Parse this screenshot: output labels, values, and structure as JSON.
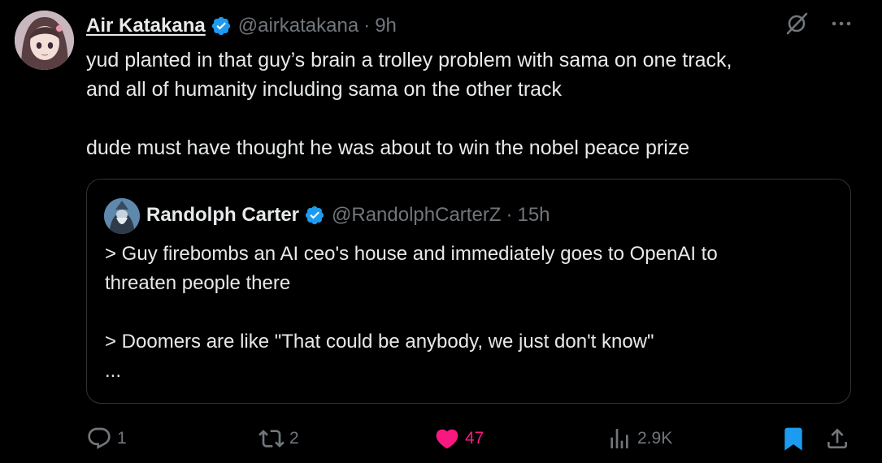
{
  "tweet": {
    "author": {
      "display_name": "Air Katakana",
      "handle": "@airkatakana",
      "verified": true
    },
    "separator": "·",
    "time": "9h",
    "text": [
      "yud planted in that guy’s brain a trolley problem with sama on one track,",
      "and all of humanity including sama on the other track",
      "dude must have thought he was about to win the nobel peace prize"
    ],
    "top_icons": [
      "grok-icon",
      "more-icon"
    ]
  },
  "quote": {
    "author": {
      "display_name": "Randolph Carter",
      "handle": "@RandolphCarterZ",
      "verified": true
    },
    "separator": "·",
    "time": "15h",
    "text": [
      "> Guy firebombs an AI ceo's house and immediately goes to OpenAI to",
      "threaten people there",
      "> Doomers are like \"That could be anybody, we just don't know\"",
      "..."
    ]
  },
  "actions": {
    "reply": {
      "icon": "reply-icon",
      "count": "1"
    },
    "retweet": {
      "icon": "retweet-icon",
      "count": "2"
    },
    "like": {
      "icon": "heart-icon",
      "count": "47",
      "liked": true
    },
    "views": {
      "icon": "views-icon",
      "count": "2.9K"
    },
    "bookmark": {
      "icon": "bookmark-icon",
      "bookmarked": true
    },
    "share": {
      "icon": "share-icon"
    }
  },
  "colors": {
    "background": "#000000",
    "text": "#e7e9ea",
    "muted": "#71767b",
    "verified": "#1d9bf0",
    "like": "#f91880",
    "bookmark": "#1d9bf0",
    "border": "#2f3336"
  }
}
